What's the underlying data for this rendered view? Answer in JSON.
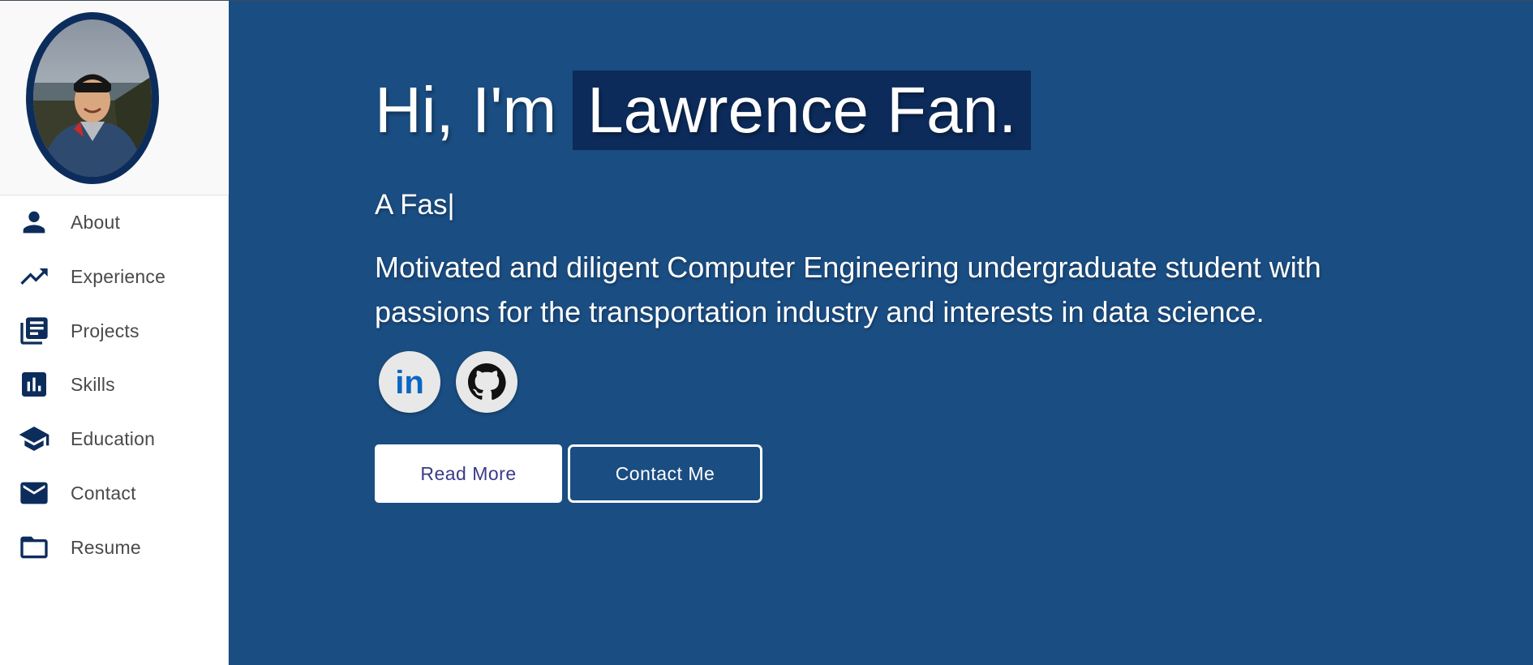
{
  "sidebar": {
    "items": [
      {
        "label": "About",
        "icon": "person-icon"
      },
      {
        "label": "Experience",
        "icon": "trending-up-icon"
      },
      {
        "label": "Projects",
        "icon": "library-books-icon"
      },
      {
        "label": "Skills",
        "icon": "bar-chart-icon"
      },
      {
        "label": "Education",
        "icon": "graduation-cap-icon"
      },
      {
        "label": "Contact",
        "icon": "mail-icon"
      },
      {
        "label": "Resume",
        "icon": "folder-icon"
      }
    ]
  },
  "hero": {
    "intro": "Hi, I'm",
    "name": "Lawrence Fan.",
    "typed": "A Fas",
    "cursor": "|",
    "description": "Motivated and diligent Computer Engineering undergraduate student with passions for the transportation industry and interests in data science.",
    "linkedin_text": "in",
    "read_more": "Read More",
    "contact_me": "Contact Me"
  },
  "colors": {
    "main_bg": "#1a4d82",
    "name_highlight": "#0c2b5a",
    "icon_navy": "#0c2d5c",
    "linkedin_blue": "#0a66c2"
  }
}
